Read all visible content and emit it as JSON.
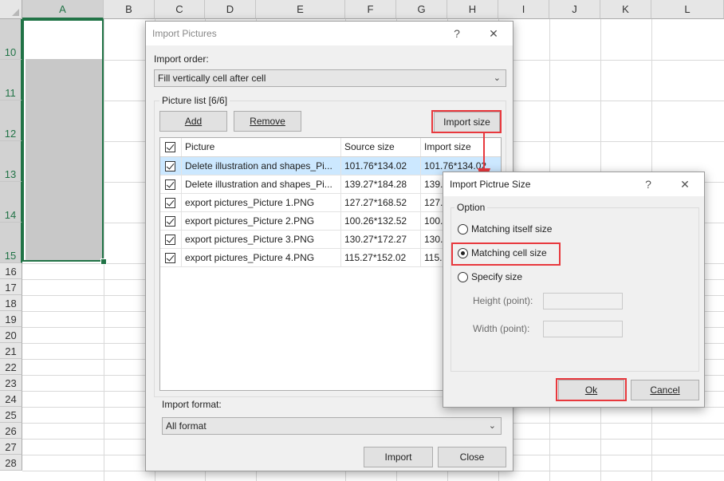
{
  "sheet": {
    "columns": [
      "A",
      "B",
      "C",
      "D",
      "E",
      "F",
      "G",
      "H",
      "I",
      "J",
      "K",
      "L"
    ],
    "rows": [
      "10",
      "11",
      "12",
      "13",
      "14",
      "15",
      "16",
      "17",
      "18",
      "19",
      "20",
      "21",
      "22",
      "23",
      "24",
      "25",
      "26",
      "27",
      "28"
    ]
  },
  "import_dialog": {
    "title": "Import Pictures",
    "help": "?",
    "close": "✕",
    "import_order_label": "Import order:",
    "import_order_value": "Fill vertically cell after cell",
    "picture_list_label": "Picture list [6/6]",
    "add_label": "Add",
    "remove_label": "Remove",
    "import_size_label": "Import size",
    "columns": [
      "Picture",
      "Source size",
      "Import size"
    ],
    "rows": [
      {
        "picture": "Delete illustration and shapes_Pi...",
        "source": "101.76*134.02",
        "import": "101.76*134.02"
      },
      {
        "picture": "Delete illustration and shapes_Pi...",
        "source": "139.27*184.28",
        "import": "139."
      },
      {
        "picture": "export pictures_Picture 1.PNG",
        "source": "127.27*168.52",
        "import": "127."
      },
      {
        "picture": "export pictures_Picture 2.PNG",
        "source": "100.26*132.52",
        "import": "100."
      },
      {
        "picture": "export pictures_Picture 3.PNG",
        "source": "130.27*172.27",
        "import": "130."
      },
      {
        "picture": "export pictures_Picture 4.PNG",
        "source": "115.27*152.02",
        "import": "115."
      }
    ],
    "import_format_label": "Import format:",
    "import_format_value": "All format",
    "import_button": "Import",
    "close_button": "Close"
  },
  "size_dialog": {
    "title": "Import Pictrue Size",
    "help": "?",
    "close": "✕",
    "option_label": "Option",
    "options": [
      "Matching itself size",
      "Matching cell size",
      "Specify size"
    ],
    "selected_option": "Matching cell size",
    "height_label": "Height (point):",
    "width_label": "Width (point):",
    "ok_label": "Ok",
    "cancel_label": "Cancel"
  },
  "colors": {
    "highlight": "#e8383d",
    "excel_green": "#217346",
    "selected_row": "#cce8ff"
  }
}
